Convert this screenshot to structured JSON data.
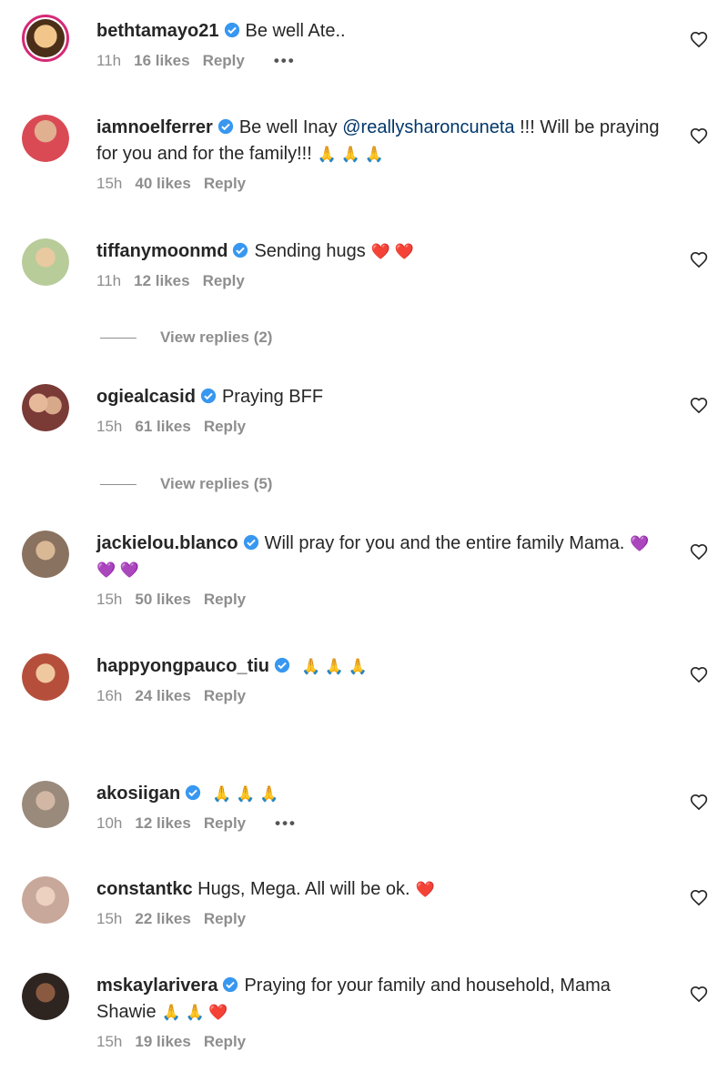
{
  "comments": [
    {
      "username": "bethtamayo21",
      "verified": true,
      "text": "Be well Ate..",
      "time": "11h",
      "likes": "16 likes",
      "reply": "Reply",
      "more": "•••",
      "story_ring": true,
      "avatar_color": "#c9964a"
    },
    {
      "username": "iamnoelferrer",
      "verified": true,
      "text_prefix": "Be well Inay ",
      "mention": "@reallysharoncuneta",
      "text": " !!! Will be praying for you and for the family!!!",
      "emoji": "🙏 🙏 🙏",
      "time": "15h",
      "likes": "40 likes",
      "reply": "Reply",
      "avatar_color": "#d94a55"
    },
    {
      "username": "tiffanymoonmd",
      "verified": true,
      "text": "Sending hugs",
      "emoji": "❤️ ❤️",
      "time": "11h",
      "likes": "12 likes",
      "reply": "Reply",
      "view_replies": "View replies (2)",
      "avatar_color": "#b8cc9a"
    },
    {
      "username": "ogiealcasid",
      "verified": true,
      "text": "Praying BFF",
      "time": "15h",
      "likes": "61 likes",
      "reply": "Reply",
      "view_replies": "View replies (5)",
      "avatar_color": "#7a3a36"
    },
    {
      "username": "jackielou.blanco",
      "verified": true,
      "text": "Will pray for you and the entire family Mama.",
      "emoji": "💜 💜 💜",
      "time": "15h",
      "likes": "50 likes",
      "reply": "Reply",
      "avatar_color": "#8a7260"
    },
    {
      "username": "happyongpauco_tiu",
      "verified": true,
      "text": "",
      "emoji": "🙏 🙏 🙏",
      "time": "16h",
      "likes": "24 likes",
      "reply": "Reply",
      "avatar_color": "#b54f3c"
    },
    {
      "username": "akosiigan",
      "verified": true,
      "text": "",
      "emoji": "🙏 🙏 🙏",
      "time": "10h",
      "likes": "12 likes",
      "reply": "Reply",
      "more": "•••",
      "avatar_color": "#9a8a7c"
    },
    {
      "username": "constantkc",
      "verified": false,
      "text": "Hugs, Mega. All will be ok.",
      "emoji": "❤️",
      "time": "15h",
      "likes": "22 likes",
      "reply": "Reply",
      "avatar_color": "#c8a89a"
    },
    {
      "username": "mskaylarivera",
      "verified": true,
      "text": "Praying for your family and household, Mama Shawie",
      "emoji": "🙏 🙏 ❤️",
      "time": "15h",
      "likes": "19 likes",
      "reply": "Reply",
      "avatar_color": "#2e2420"
    }
  ],
  "colors": {
    "text": "#262626",
    "meta": "#8e8e8e",
    "mention": "#00376b",
    "verified": "#3897f0",
    "story_ring": "#d62976"
  },
  "icons": {
    "like": "heart-outline-icon",
    "verified": "verified-badge-icon"
  }
}
